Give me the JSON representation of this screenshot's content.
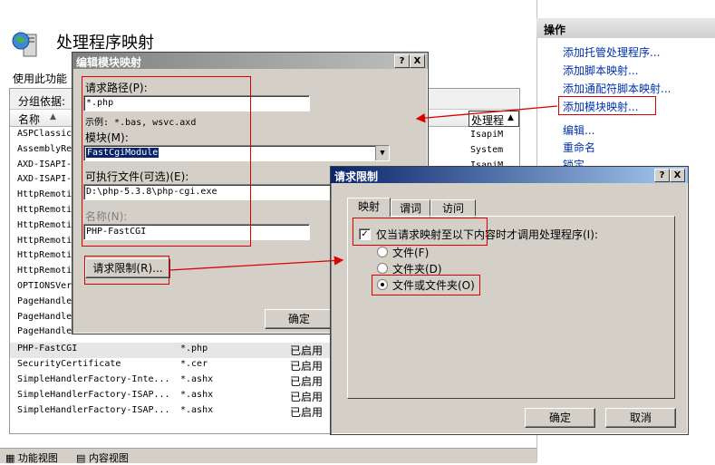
{
  "main": {
    "title": "处理程序映射",
    "description": "使用此功能",
    "group_by_label": "分组依据:",
    "col_name": "名称",
    "col_handler": "处理程",
    "col_handler_values": [
      "IsapiM",
      "System",
      "IsapiM"
    ],
    "rows_top": [
      "ASPClassic",
      "AssemblyRe",
      "AXD-ISAPI-",
      "AXD-ISAPI-",
      "HttpRemoti",
      "HttpRemoti",
      "HttpRemoti",
      "HttpRemoti",
      "HttpRemoti",
      "HttpRemoti",
      "OPTIONSVer",
      "PageHandle",
      "PageHandle",
      "PageHandle"
    ],
    "rows_bottom": [
      {
        "name": "PHP-FastCGI",
        "path": "*.php",
        "state": "已启用"
      },
      {
        "name": "SecurityCertificate",
        "path": "*.cer",
        "state": "已启用"
      },
      {
        "name": "SimpleHandlerFactory-Inte...",
        "path": "*.ashx",
        "state": "已启用"
      },
      {
        "name": "SimpleHandlerFactory-ISAP...",
        "path": "*.ashx",
        "state": "已启用"
      },
      {
        "name": "SimpleHandlerFactory-ISAP...",
        "path": "*.ashx",
        "state": "已启用"
      }
    ],
    "bottom_tabs": [
      "功能视图",
      "内容视图"
    ]
  },
  "actions": {
    "title": "操作",
    "items": [
      "添加托管处理程序...",
      "添加脚本映射...",
      "添加通配符脚本映射...",
      "添加模块映射...",
      "编辑...",
      "重命名",
      "锁定"
    ]
  },
  "edit_dialog": {
    "title": "编辑模块映射",
    "request_path_label": "请求路径(P):",
    "request_path_value": "*.php",
    "example": "示例: *.bas, wsvc.axd",
    "module_label": "模块(M):",
    "module_value": "FastCgiModule",
    "executable_label": "可执行文件(可选)(E):",
    "executable_value": "D:\\php-5.3.8\\php-cgi.exe",
    "name_label": "名称(N):",
    "name_value": "PHP-FastCGI",
    "restrictions_button": "请求限制(R)...",
    "ok_button": "确定",
    "help_btn": "?",
    "close_btn": "X"
  },
  "restrict_dialog": {
    "title": "请求限制",
    "tabs": [
      "映射",
      "谓词",
      "访问"
    ],
    "checkbox_label": "仅当请求映射至以下内容时才调用处理程序(I):",
    "checkbox_checked": true,
    "options": [
      "文件(F)",
      "文件夹(D)",
      "文件或文件夹(O)"
    ],
    "selected_option": "文件或文件夹(O)",
    "ok_button": "确定",
    "cancel_button": "取消",
    "help_btn": "?",
    "close_btn": "X"
  },
  "colors": {
    "dialog_title": "#0a246a",
    "dialog_title_end": "#a6caf0",
    "annotation": "#dd0000"
  }
}
